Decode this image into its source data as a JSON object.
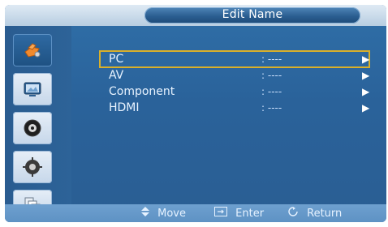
{
  "window": {
    "title": "Edit Name"
  },
  "sidebar": {
    "items": [
      {
        "icon": "input-icon",
        "selected": true
      },
      {
        "icon": "picture-icon",
        "selected": false
      },
      {
        "icon": "sound-icon",
        "selected": false
      },
      {
        "icon": "setup-icon",
        "selected": false
      },
      {
        "icon": "multi-control-icon",
        "selected": false
      }
    ]
  },
  "list": {
    "items": [
      {
        "label": "PC",
        "value": ": ----",
        "arrow": "▶",
        "selected": true
      },
      {
        "label": "AV",
        "value": ": ----",
        "arrow": "▶",
        "selected": false
      },
      {
        "label": "Component",
        "value": ": ----",
        "arrow": "▶",
        "selected": false
      },
      {
        "label": "HDMI",
        "value": ": ----",
        "arrow": "▶",
        "selected": false
      }
    ]
  },
  "footer": {
    "move_label": "Move",
    "enter_label": "Enter",
    "return_label": "Return"
  },
  "colors": {
    "accent_selected_outline": "#d9b02a",
    "osd_blue": "#2f6fa8"
  }
}
